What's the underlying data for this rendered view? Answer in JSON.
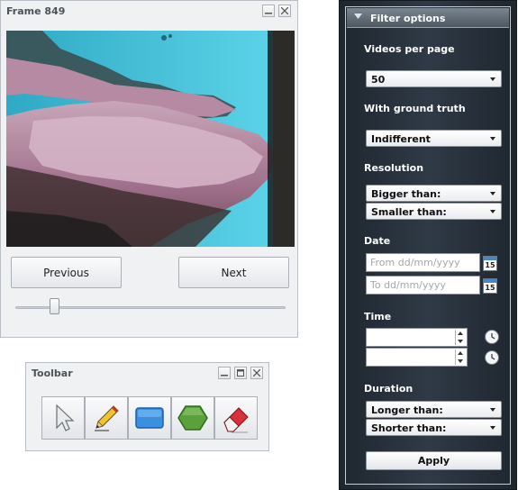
{
  "frame_window": {
    "title": "Frame 849",
    "previous_label": "Previous",
    "next_label": "Next",
    "slider_position": 0.13
  },
  "toolbar_window": {
    "title": "Toolbar",
    "tools": [
      "pointer-tool",
      "pencil-tool",
      "rectangle-tool",
      "hexagon-tool",
      "eraser-tool"
    ]
  },
  "filter_panel": {
    "header": "Filter options",
    "videos_per_page": {
      "label": "Videos per page",
      "value": "50"
    },
    "ground_truth": {
      "label": "With ground truth",
      "value": "Indifferent"
    },
    "resolution": {
      "label": "Resolution",
      "bigger": "Bigger than:",
      "smaller": "Smaller than:"
    },
    "date": {
      "label": "Date",
      "from_placeholder": "From dd/mm/yyyy",
      "to_placeholder": "To dd/mm/yyyy",
      "calendar_day": "15"
    },
    "time": {
      "label": "Time"
    },
    "duration": {
      "label": "Duration",
      "longer": "Longer than:",
      "shorter": "Shorter than:"
    },
    "apply_label": "Apply"
  },
  "colors": {
    "panel_bg": "#eff1f3",
    "filter_bg": "#2b3540",
    "rectangle_tool": "#3a8fe0",
    "hexagon_tool": "#5aa13c",
    "eraser_tool": "#d9313a"
  }
}
